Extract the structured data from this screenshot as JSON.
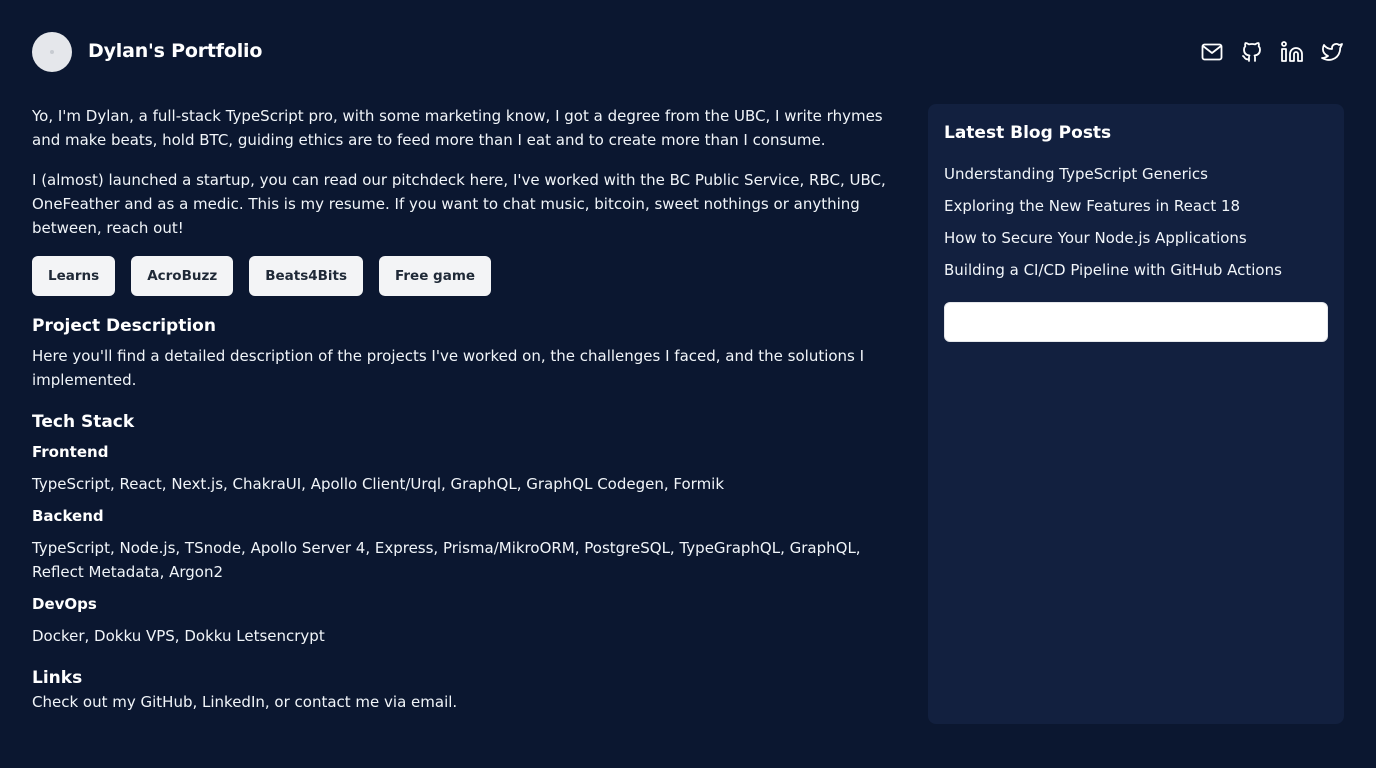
{
  "header": {
    "title": "Dylan's Portfolio",
    "social_icons": [
      "mail-icon",
      "github-icon",
      "linkedin-icon",
      "twitter-icon"
    ]
  },
  "intro": {
    "p1": "Yo, I'm Dylan, a full-stack TypeScript pro, with some marketing know, I got a degree from the UBC, I write rhymes and make beats, hold BTC, guiding ethics are to feed more than I eat and to create more than I consume.",
    "p2": "I (almost) launched a startup, you can read our pitchdeck here, I've worked with the BC Public Service, RBC, UBC, OneFeather and as a medic. This is my resume. If you want to chat music, bitcoin, sweet nothings or anything between, reach out!"
  },
  "buttons": [
    "Learns",
    "AcroBuzz",
    "Beats4Bits",
    "Free game"
  ],
  "project": {
    "title": "Project Description",
    "text": "Here you'll find a detailed description of the projects I've worked on, the challenges I faced, and the solutions I implemented."
  },
  "tech": {
    "title": "Tech Stack",
    "sections": [
      {
        "title": "Frontend",
        "text": "TypeScript, React, Next.js, ChakraUI, Apollo Client/Urql, GraphQL, GraphQL Codegen, Formik"
      },
      {
        "title": "Backend",
        "text": "TypeScript, Node.js, TSnode, Apollo Server 4, Express, Prisma/MikroORM, PostgreSQL, TypeGraphQL, GraphQL, Reflect Metadata, Argon2"
      },
      {
        "title": "DevOps",
        "text": "Docker, Dokku VPS, Dokku Letsencrypt"
      }
    ]
  },
  "links": {
    "title": "Links",
    "text": "Check out my GitHub, LinkedIn, or contact me via email."
  },
  "sidebar": {
    "title": "Latest Blog Posts",
    "posts": [
      "Understanding TypeScript Generics",
      "Exploring the New Features in React 18",
      "How to Secure Your Node.js Applications",
      "Building a CI/CD Pipeline with GitHub Actions"
    ],
    "input_value": ""
  },
  "colors": {
    "background": "#0b1730",
    "sidebar": "#12203f",
    "button_bg": "#f3f4f6",
    "text": "#f1f5f9"
  }
}
